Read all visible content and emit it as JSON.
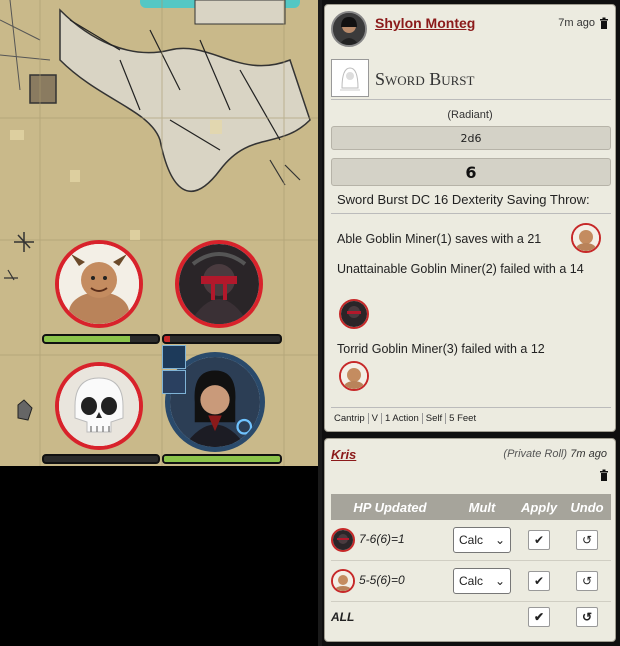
{
  "chat": {
    "roll_card": {
      "username": "Shylon Monteg",
      "timestamp": "7m ago",
      "spell_name": "Sword Burst",
      "damage_type": "(Radiant)",
      "dice": "2d6",
      "result": "6",
      "save_title": "Sword Burst DC 16 Dexterity Saving Throw:",
      "results": [
        "Able Goblin Miner(1) saves with a 21",
        "Unattainable Goblin Miner(2) failed with a 14",
        "Torrid Goblin Miner(3) failed with a 12"
      ],
      "tags": [
        "Cantrip",
        "V",
        "1 Action",
        "Self",
        "5 Feet"
      ]
    },
    "hp_card": {
      "username": "Kris",
      "private_label": "(Private Roll)",
      "timestamp": "7m ago",
      "headers": [
        "HP Updated",
        "Mult",
        "Apply",
        "Undo"
      ],
      "rows": [
        {
          "formula": "7-6(6)=1",
          "mult": "Calc"
        },
        {
          "formula": "5-5(6)=0",
          "mult": "Calc"
        }
      ],
      "all_label": "ALL"
    }
  },
  "map": {
    "tokens": [
      {
        "name": "goblin-horned",
        "hp_fraction": 0.75
      },
      {
        "name": "red-masked-figure",
        "hp_fraction": 0.05
      },
      {
        "name": "skull-defeated",
        "hp_fraction": 0.0
      },
      {
        "name": "dark-haired-caster",
        "hp_fraction": 1.0
      }
    ]
  },
  "icons": {
    "trash": "trash-icon",
    "check": "check-icon",
    "undo": "undo-icon",
    "chevron": "chevron-down-icon"
  },
  "colors": {
    "accent_red": "#8b1a1a",
    "token_border": "#d8222b",
    "hp_green": "#8bc34a",
    "card_bg": "#ecebe0"
  }
}
